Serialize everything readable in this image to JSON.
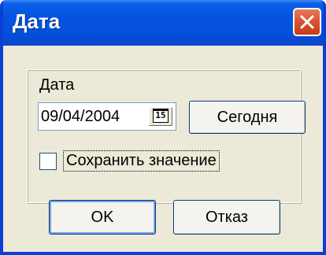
{
  "window": {
    "title": "Дата",
    "close_icon": "close-x-icon",
    "titlebar_color": "#0453e0",
    "close_color": "#d8512f"
  },
  "form": {
    "group_label": "Дата",
    "date_value": "09/04/2004",
    "calendar_button_text": "15",
    "today_button": "Сегодня",
    "save_checkbox_label": "Сохранить значение",
    "save_checkbox_checked": false
  },
  "buttons": {
    "ok": "OK",
    "cancel": "Отказ"
  }
}
